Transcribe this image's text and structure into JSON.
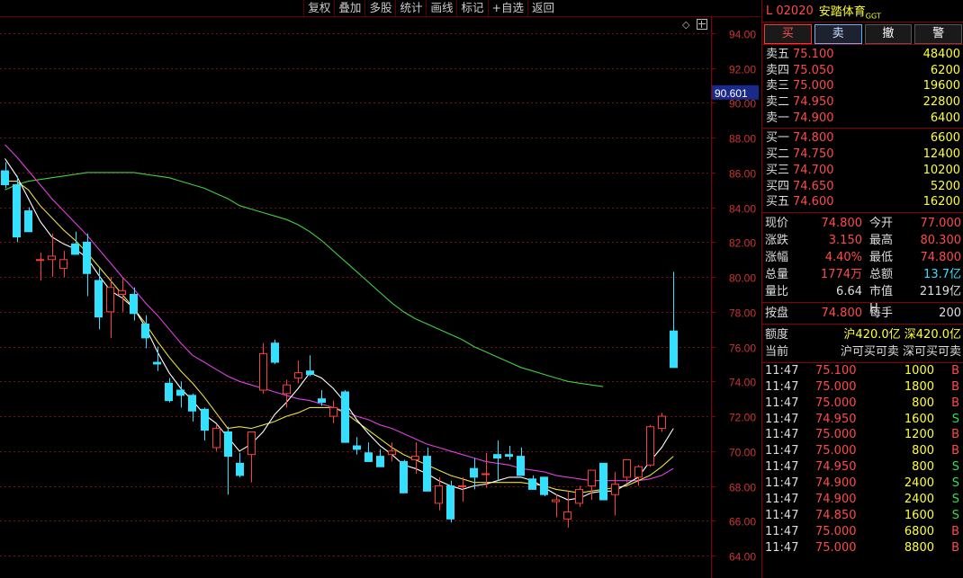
{
  "toolbar": [
    "复权",
    "叠加",
    "多股",
    "统计",
    "画线",
    "标记",
    "+自选",
    "返回"
  ],
  "crosshair_label": "90.601",
  "header": {
    "code": "L  02020",
    "name": "安踏体育",
    "suffix": "GGT"
  },
  "trade_buttons": [
    {
      "label": "买",
      "kind": "buy"
    },
    {
      "label": "卖",
      "kind": "sell"
    },
    {
      "label": "撤",
      "kind": "plain"
    },
    {
      "label": "警",
      "kind": "plain"
    }
  ],
  "asks": [
    {
      "label": "卖五",
      "price": "75.100",
      "vol": "48400"
    },
    {
      "label": "卖四",
      "price": "75.050",
      "vol": "6200"
    },
    {
      "label": "卖三",
      "price": "75.000",
      "vol": "19600"
    },
    {
      "label": "卖二",
      "price": "74.950",
      "vol": "22800"
    },
    {
      "label": "卖一",
      "price": "74.900",
      "vol": "6400"
    }
  ],
  "bids": [
    {
      "label": "买一",
      "price": "74.800",
      "vol": "6600"
    },
    {
      "label": "买二",
      "price": "74.750",
      "vol": "12400"
    },
    {
      "label": "买三",
      "price": "74.700",
      "vol": "10200"
    },
    {
      "label": "买四",
      "price": "74.650",
      "vol": "5200"
    },
    {
      "label": "买五",
      "price": "74.600",
      "vol": "16200"
    }
  ],
  "quote": [
    {
      "k1": "现价",
      "v1": "74.800",
      "k2": "今开",
      "v2": "77.000"
    },
    {
      "k1": "涨跌",
      "v1": "3.150",
      "k2": "最高",
      "v2": "80.300"
    },
    {
      "k1": "涨幅",
      "v1": "4.40%",
      "k2": "最低",
      "v2": "74.800"
    },
    {
      "k1": "总量",
      "v1": "1774万",
      "k2": "总额",
      "v2": "13.7亿"
    },
    {
      "k1": "量比",
      "v1": "6.64",
      "k2": "市值H",
      "v2": "2119亿"
    }
  ],
  "lot": {
    "k1": "按盘",
    "v1": "74.800",
    "k2": "每手",
    "v2": "200"
  },
  "quota": {
    "k": "额度",
    "v": "沪420.0亿 深420.0亿"
  },
  "current": {
    "k": "当前",
    "v": "沪可买可卖 深可买可卖"
  },
  "ticks": [
    {
      "t": "11:47",
      "p": "75.100",
      "q": "1000",
      "s": "B"
    },
    {
      "t": "11:47",
      "p": "75.000",
      "q": "1800",
      "s": "B"
    },
    {
      "t": "11:47",
      "p": "75.000",
      "q": "800",
      "s": "B"
    },
    {
      "t": "11:47",
      "p": "74.950",
      "q": "1600",
      "s": "S"
    },
    {
      "t": "11:47",
      "p": "75.000",
      "q": "1200",
      "s": "B"
    },
    {
      "t": "11:47",
      "p": "75.000",
      "q": "800",
      "s": "B"
    },
    {
      "t": "11:47",
      "p": "74.950",
      "q": "800",
      "s": "S"
    },
    {
      "t": "11:47",
      "p": "74.900",
      "q": "2400",
      "s": "S"
    },
    {
      "t": "11:47",
      "p": "74.900",
      "q": "2400",
      "s": "S"
    },
    {
      "t": "11:47",
      "p": "74.850",
      "q": "1600",
      "s": "S"
    },
    {
      "t": "11:47",
      "p": "75.000",
      "q": "6800",
      "s": "B"
    },
    {
      "t": "11:47",
      "p": "75.000",
      "q": "8800",
      "s": "B"
    }
  ],
  "colors": {
    "up": "#ff3c3c",
    "down": "#33e0ff",
    "ma5": "#ffffff",
    "ma10": "#e8e040",
    "ma20": "#e040e0",
    "ma60": "#40d040"
  },
  "chart_data": {
    "type": "candlestick",
    "y_ticks": [
      "94.00",
      "92.00",
      "90.00",
      "88.00",
      "86.00",
      "84.00",
      "82.00",
      "80.00",
      "78.00",
      "76.00",
      "74.00",
      "72.00",
      "70.00",
      "68.00",
      "66.00",
      "64.00"
    ],
    "ylim": [
      63,
      95
    ],
    "candles": [
      [
        86.1,
        86.6,
        85.1,
        85.3
      ],
      [
        85.3,
        85.8,
        82.0,
        82.3
      ],
      [
        83.8,
        84.0,
        82.6,
        82.6
      ],
      [
        81.0,
        81.4,
        79.8,
        81.0
      ],
      [
        81.0,
        82.5,
        80.0,
        81.2
      ],
      [
        80.5,
        81.5,
        80.0,
        81.0
      ],
      [
        81.9,
        82.6,
        81.3,
        81.3
      ],
      [
        82.0,
        82.5,
        78.9,
        80.2
      ],
      [
        79.8,
        80.5,
        77.0,
        77.7
      ],
      [
        78.0,
        80.0,
        76.5,
        79.4
      ],
      [
        79.0,
        80.0,
        78.0,
        79.2
      ],
      [
        79.0,
        79.4,
        77.5,
        77.9
      ],
      [
        77.3,
        77.8,
        75.9,
        76.5
      ],
      [
        75.1,
        76.0,
        74.6,
        75.0
      ],
      [
        73.9,
        74.2,
        72.8,
        72.9
      ],
      [
        73.5,
        74.0,
        72.5,
        73.2
      ],
      [
        73.2,
        73.3,
        71.7,
        72.3
      ],
      [
        72.4,
        72.5,
        70.6,
        71.2
      ],
      [
        70.2,
        71.5,
        70.0,
        71.3
      ],
      [
        71.1,
        71.4,
        67.5,
        69.7
      ],
      [
        69.3,
        69.9,
        68.5,
        68.6
      ],
      [
        69.8,
        70.5,
        68.2,
        71.1
      ],
      [
        73.5,
        76.2,
        73.3,
        75.6
      ],
      [
        76.2,
        76.4,
        75.0,
        75.1
      ],
      [
        73.3,
        74.1,
        72.5,
        73.8
      ],
      [
        74.2,
        75.2,
        73.9,
        74.5
      ],
      [
        74.6,
        75.5,
        74.3,
        74.4
      ],
      [
        73.0,
        73.5,
        72.6,
        72.8
      ],
      [
        72.0,
        72.9,
        71.6,
        72.5
      ],
      [
        73.4,
        73.5,
        70.5,
        70.5
      ],
      [
        70.3,
        70.8,
        69.8,
        70.1
      ],
      [
        69.9,
        70.5,
        69.4,
        69.4
      ],
      [
        69.7,
        70.1,
        69.2,
        69.1
      ],
      [
        69.8,
        70.5,
        69.4,
        70.0
      ],
      [
        69.4,
        69.5,
        67.7,
        67.6
      ],
      [
        69.5,
        70.5,
        68.7,
        69.7
      ],
      [
        69.7,
        70.2,
        67.9,
        67.7
      ],
      [
        67.0,
        68.5,
        66.6,
        68.0
      ],
      [
        68.0,
        68.3,
        65.9,
        66.1
      ],
      [
        68.0,
        68.5,
        67.1,
        68.0
      ],
      [
        69.0,
        69.6,
        67.8,
        68.5
      ],
      [
        68.7,
        69.9,
        67.9,
        68.7
      ],
      [
        69.8,
        70.6,
        68.3,
        69.6
      ],
      [
        69.8,
        70.3,
        69.5,
        69.7
      ],
      [
        69.7,
        70.2,
        68.6,
        68.6
      ],
      [
        68.4,
        68.6,
        67.8,
        67.8
      ],
      [
        68.5,
        68.5,
        67.4,
        67.5
      ],
      [
        67.1,
        67.5,
        66.2,
        67.2
      ],
      [
        66.1,
        67.7,
        65.6,
        66.5
      ],
      [
        67.0,
        68.0,
        66.8,
        67.8
      ],
      [
        68.0,
        68.5,
        67.2,
        68.9
      ],
      [
        69.3,
        69.3,
        67.2,
        67.2
      ],
      [
        67.5,
        68.8,
        66.3,
        68.1
      ],
      [
        68.5,
        69.5,
        68.2,
        69.5
      ],
      [
        68.5,
        69.2,
        68.0,
        69.1
      ],
      [
        69.2,
        71.5,
        69.1,
        71.4
      ],
      [
        71.3,
        72.2,
        71.1,
        72.0
      ],
      [
        76.9,
        80.3,
        74.8,
        74.8
      ]
    ],
    "ma5": [
      [
        0,
        86.8
      ],
      [
        1,
        85.8
      ],
      [
        2,
        84.5
      ],
      [
        3,
        83.2
      ],
      [
        4,
        82.3
      ],
      [
        5,
        81.9
      ],
      [
        6,
        81.6
      ],
      [
        7,
        81.1
      ],
      [
        8,
        80.1
      ],
      [
        9,
        79.2
      ],
      [
        10,
        78.8
      ],
      [
        11,
        78.2
      ],
      [
        12,
        77.1
      ],
      [
        13,
        75.7
      ],
      [
        14,
        74.5
      ],
      [
        15,
        73.6
      ],
      [
        16,
        72.9
      ],
      [
        17,
        72.1
      ],
      [
        18,
        71.6
      ],
      [
        19,
        70.8
      ],
      [
        20,
        70.0
      ],
      [
        21,
        70.4
      ],
      [
        22,
        71.1
      ],
      [
        23,
        72.1
      ],
      [
        24,
        72.8
      ],
      [
        25,
        73.6
      ],
      [
        26,
        74.5
      ],
      [
        27,
        74.2
      ],
      [
        28,
        73.6
      ],
      [
        29,
        72.8
      ],
      [
        30,
        71.8
      ],
      [
        31,
        71.0
      ],
      [
        32,
        70.3
      ],
      [
        33,
        69.8
      ],
      [
        34,
        69.2
      ],
      [
        35,
        69.0
      ],
      [
        36,
        68.7
      ],
      [
        37,
        68.3
      ],
      [
        38,
        68.0
      ],
      [
        39,
        67.8
      ],
      [
        40,
        68.0
      ],
      [
        41,
        68.1
      ],
      [
        42,
        68.3
      ],
      [
        43,
        68.5
      ],
      [
        44,
        68.5
      ],
      [
        45,
        68.3
      ],
      [
        46,
        67.9
      ],
      [
        47,
        67.5
      ],
      [
        48,
        67.2
      ],
      [
        49,
        67.3
      ],
      [
        50,
        67.6
      ],
      [
        51,
        67.7
      ],
      [
        52,
        67.7
      ],
      [
        53,
        68.1
      ],
      [
        54,
        68.5
      ],
      [
        55,
        69.4
      ],
      [
        56,
        70.2
      ],
      [
        57,
        71.3
      ]
    ],
    "ma10": [
      [
        0,
        85.5
      ],
      [
        1,
        85.5
      ],
      [
        2,
        85.0
      ],
      [
        3,
        84.1
      ],
      [
        4,
        83.4
      ],
      [
        5,
        82.7
      ],
      [
        6,
        82.1
      ],
      [
        7,
        81.4
      ],
      [
        8,
        80.6
      ],
      [
        9,
        79.8
      ],
      [
        10,
        79.0
      ],
      [
        11,
        78.2
      ],
      [
        12,
        77.3
      ],
      [
        13,
        76.3
      ],
      [
        14,
        75.4
      ],
      [
        15,
        74.6
      ],
      [
        16,
        73.9
      ],
      [
        17,
        73.1
      ],
      [
        18,
        72.2
      ],
      [
        19,
        71.3
      ],
      [
        20,
        71.4
      ],
      [
        21,
        71.3
      ],
      [
        22,
        71.5
      ],
      [
        23,
        71.7
      ],
      [
        24,
        72.0
      ],
      [
        25,
        72.2
      ],
      [
        26,
        72.5
      ],
      [
        27,
        72.5
      ],
      [
        28,
        72.5
      ],
      [
        29,
        72.2
      ],
      [
        30,
        71.7
      ],
      [
        31,
        71.2
      ],
      [
        32,
        70.7
      ],
      [
        33,
        70.2
      ],
      [
        34,
        69.8
      ],
      [
        35,
        69.5
      ],
      [
        36,
        69.2
      ],
      [
        37,
        68.9
      ],
      [
        38,
        68.6
      ],
      [
        39,
        68.4
      ],
      [
        40,
        68.2
      ],
      [
        41,
        68.2
      ],
      [
        42,
        68.2
      ],
      [
        43,
        68.2
      ],
      [
        44,
        68.2
      ],
      [
        45,
        68.1
      ],
      [
        46,
        68.0
      ],
      [
        47,
        67.8
      ],
      [
        48,
        67.7
      ],
      [
        49,
        67.6
      ],
      [
        50,
        67.7
      ],
      [
        51,
        67.8
      ],
      [
        52,
        67.9
      ],
      [
        53,
        68.0
      ],
      [
        54,
        68.3
      ],
      [
        55,
        68.6
      ],
      [
        56,
        69.1
      ],
      [
        57,
        69.7
      ]
    ],
    "ma20": [
      [
        0,
        87.6
      ],
      [
        1,
        86.9
      ],
      [
        2,
        86.1
      ],
      [
        3,
        85.3
      ],
      [
        4,
        84.5
      ],
      [
        5,
        83.8
      ],
      [
        6,
        83.1
      ],
      [
        7,
        82.4
      ],
      [
        8,
        81.6
      ],
      [
        9,
        80.8
      ],
      [
        10,
        80.0
      ],
      [
        11,
        79.3
      ],
      [
        12,
        78.5
      ],
      [
        13,
        77.8
      ],
      [
        14,
        77.0
      ],
      [
        15,
        76.2
      ],
      [
        16,
        75.5
      ],
      [
        17,
        75.1
      ],
      [
        18,
        74.7
      ],
      [
        19,
        74.3
      ],
      [
        20,
        74.0
      ],
      [
        21,
        73.8
      ],
      [
        22,
        73.6
      ],
      [
        23,
        73.4
      ],
      [
        24,
        73.2
      ],
      [
        25,
        73.0
      ],
      [
        26,
        72.9
      ],
      [
        27,
        72.7
      ],
      [
        28,
        72.5
      ],
      [
        29,
        72.3
      ],
      [
        30,
        72.0
      ],
      [
        31,
        71.8
      ],
      [
        32,
        71.5
      ],
      [
        33,
        71.3
      ],
      [
        34,
        71.0
      ],
      [
        35,
        70.7
      ],
      [
        36,
        70.4
      ],
      [
        37,
        70.2
      ],
      [
        38,
        70.0
      ],
      [
        39,
        69.8
      ],
      [
        40,
        69.6
      ],
      [
        41,
        69.4
      ],
      [
        42,
        69.3
      ],
      [
        43,
        69.2
      ],
      [
        44,
        69.0
      ],
      [
        45,
        68.9
      ],
      [
        46,
        68.8
      ],
      [
        47,
        68.6
      ],
      [
        48,
        68.5
      ],
      [
        49,
        68.4
      ],
      [
        50,
        68.3
      ],
      [
        51,
        68.3
      ],
      [
        52,
        68.3
      ],
      [
        53,
        68.3
      ],
      [
        54,
        68.3
      ],
      [
        55,
        68.4
      ],
      [
        56,
        68.6
      ],
      [
        57,
        69.0
      ]
    ],
    "ma60": [
      [
        0,
        85.0
      ],
      [
        1,
        85.3
      ],
      [
        2,
        85.5
      ],
      [
        3,
        85.6
      ],
      [
        4,
        85.7
      ],
      [
        5,
        85.8
      ],
      [
        6,
        85.9
      ],
      [
        7,
        86.0
      ],
      [
        8,
        86.0
      ],
      [
        9,
        86.0
      ],
      [
        10,
        86.0
      ],
      [
        11,
        86.0
      ],
      [
        12,
        85.9
      ],
      [
        13,
        85.8
      ],
      [
        14,
        85.7
      ],
      [
        15,
        85.5
      ],
      [
        16,
        85.3
      ],
      [
        17,
        85.1
      ],
      [
        18,
        84.8
      ],
      [
        19,
        84.5
      ],
      [
        20,
        84.1
      ],
      [
        21,
        83.9
      ],
      [
        22,
        83.7
      ],
      [
        23,
        83.5
      ],
      [
        24,
        83.3
      ],
      [
        25,
        83.0
      ],
      [
        26,
        82.6
      ],
      [
        27,
        82.1
      ],
      [
        28,
        81.5
      ],
      [
        29,
        80.9
      ],
      [
        30,
        80.3
      ],
      [
        31,
        79.7
      ],
      [
        32,
        79.1
      ],
      [
        33,
        78.5
      ],
      [
        34,
        78.0
      ],
      [
        35,
        77.6
      ],
      [
        36,
        77.3
      ],
      [
        37,
        77.0
      ],
      [
        38,
        76.7
      ],
      [
        39,
        76.4
      ],
      [
        40,
        76.0
      ],
      [
        41,
        75.7
      ],
      [
        42,
        75.4
      ],
      [
        43,
        75.1
      ],
      [
        44,
        74.8
      ],
      [
        45,
        74.6
      ],
      [
        46,
        74.4
      ],
      [
        47,
        74.2
      ],
      [
        48,
        74.0
      ],
      [
        49,
        73.9
      ],
      [
        50,
        73.8
      ],
      [
        51,
        73.7
      ]
    ]
  }
}
